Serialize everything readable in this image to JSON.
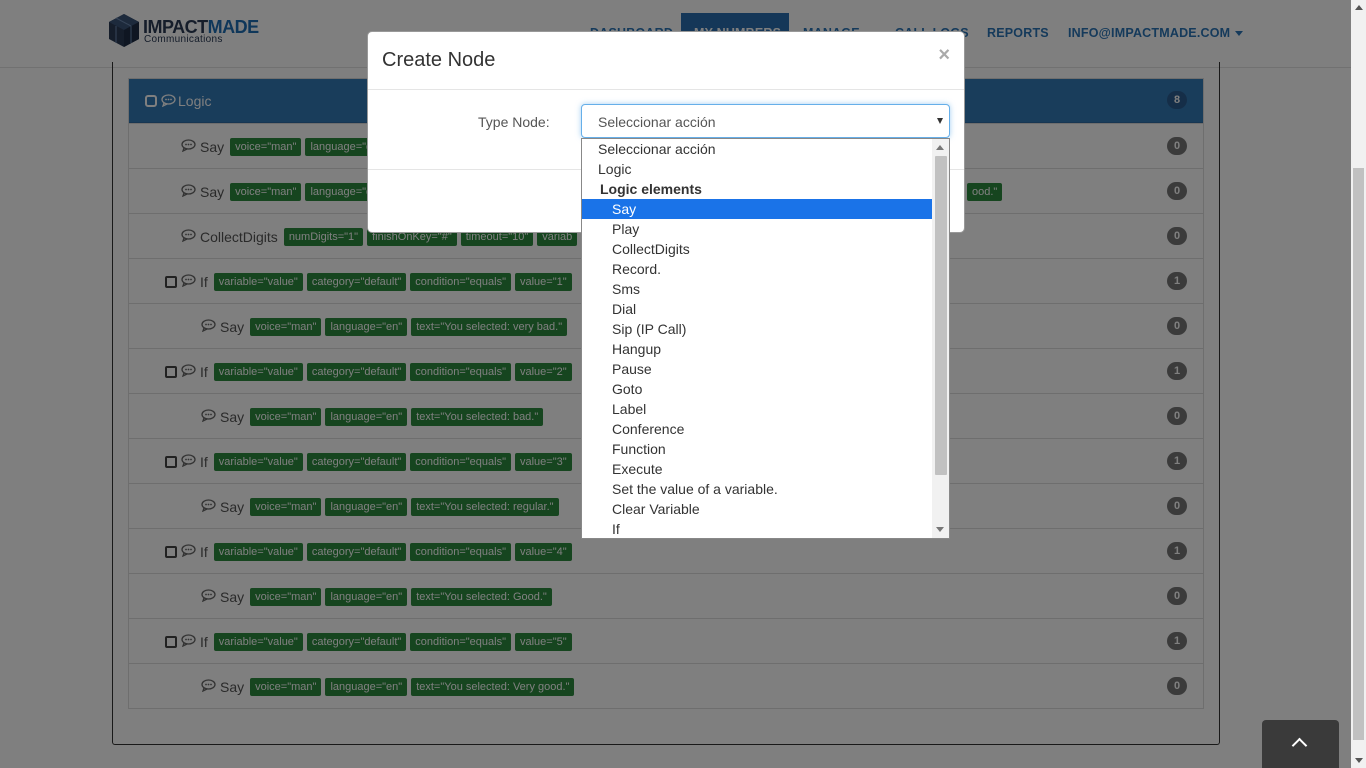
{
  "nav": {
    "logo_impact": "IMPACT",
    "logo_made": "MADE",
    "logo_sub": "Communications",
    "items": [
      "DASHBOARD",
      "MY NUMBERS",
      "MANAGE",
      "CALL LOGS",
      "REPORTS",
      "INFO@IMPACTMADE.COM"
    ]
  },
  "panel": {
    "heading_label": "Logic",
    "heading_count": "8",
    "rows": [
      {
        "type": "Say",
        "tags": [
          "voice=\"man\"",
          "language=\"en\""
        ],
        "count": "0"
      },
      {
        "type": "Say",
        "tags": [
          "voice=\"man\"",
          "language=\"en\""
        ],
        "tail_tag": "ood.\"",
        "count": "0"
      },
      {
        "type": "CollectDigits",
        "tags": [
          "numDigits=\"1\"",
          "finishOnKey=\"#\"",
          "timeout=\"10\"",
          "variab"
        ],
        "count": "0"
      },
      {
        "type": "If",
        "tags": [
          "variable=\"value\"",
          "category=\"default\"",
          "condition=\"equals\"",
          "value=\"1\""
        ],
        "count": "1"
      },
      {
        "type": "Say",
        "tags": [
          "voice=\"man\"",
          "language=\"en\"",
          "text=\"You selected: very bad.\""
        ],
        "count": "0"
      },
      {
        "type": "If",
        "tags": [
          "variable=\"value\"",
          "category=\"default\"",
          "condition=\"equals\"",
          "value=\"2\""
        ],
        "count": "1"
      },
      {
        "type": "Say",
        "tags": [
          "voice=\"man\"",
          "language=\"en\"",
          "text=\"You selected: bad.\""
        ],
        "count": "0"
      },
      {
        "type": "If",
        "tags": [
          "variable=\"value\"",
          "category=\"default\"",
          "condition=\"equals\"",
          "value=\"3\""
        ],
        "count": "1"
      },
      {
        "type": "Say",
        "tags": [
          "voice=\"man\"",
          "language=\"en\"",
          "text=\"You selected: regular.\""
        ],
        "count": "0"
      },
      {
        "type": "If",
        "tags": [
          "variable=\"value\"",
          "category=\"default\"",
          "condition=\"equals\"",
          "value=\"4\""
        ],
        "count": "1"
      },
      {
        "type": "Say",
        "tags": [
          "voice=\"man\"",
          "language=\"en\"",
          "text=\"You selected: Good.\""
        ],
        "count": "0"
      },
      {
        "type": "If",
        "tags": [
          "variable=\"value\"",
          "category=\"default\"",
          "condition=\"equals\"",
          "value=\"5\""
        ],
        "count": "1"
      },
      {
        "type": "Say",
        "tags": [
          "voice=\"man\"",
          "language=\"en\"",
          "text=\"You selected: Very good.\""
        ],
        "count": "0"
      }
    ]
  },
  "modal": {
    "title": "Create Node",
    "close": "×",
    "type_label": "Type Node:",
    "select_value": "Seleccionar acción"
  },
  "dropdown": {
    "options": [
      {
        "label": "Seleccionar acción",
        "kind": "top"
      },
      {
        "label": "Logic",
        "kind": "top"
      },
      {
        "label": "Logic elements",
        "kind": "group"
      },
      {
        "label": "Say",
        "kind": "item",
        "selected": true
      },
      {
        "label": "Play",
        "kind": "item"
      },
      {
        "label": "CollectDigits",
        "kind": "item"
      },
      {
        "label": "Record.",
        "kind": "item"
      },
      {
        "label": "Sms",
        "kind": "item"
      },
      {
        "label": "Dial",
        "kind": "item"
      },
      {
        "label": "Sip (IP Call)",
        "kind": "item"
      },
      {
        "label": "Hangup",
        "kind": "item"
      },
      {
        "label": "Pause",
        "kind": "item"
      },
      {
        "label": "Goto",
        "kind": "item"
      },
      {
        "label": "Label",
        "kind": "item"
      },
      {
        "label": "Conference",
        "kind": "item"
      },
      {
        "label": "Function",
        "kind": "item"
      },
      {
        "label": "Execute",
        "kind": "item"
      },
      {
        "label": "Set the value of a variable.",
        "kind": "item"
      },
      {
        "label": "Clear Variable",
        "kind": "item"
      },
      {
        "label": "If",
        "kind": "item"
      }
    ]
  },
  "colors": {
    "primary": "#337ab7",
    "tag_green": "#2d8a3f",
    "selected_option": "#1a73e8"
  }
}
